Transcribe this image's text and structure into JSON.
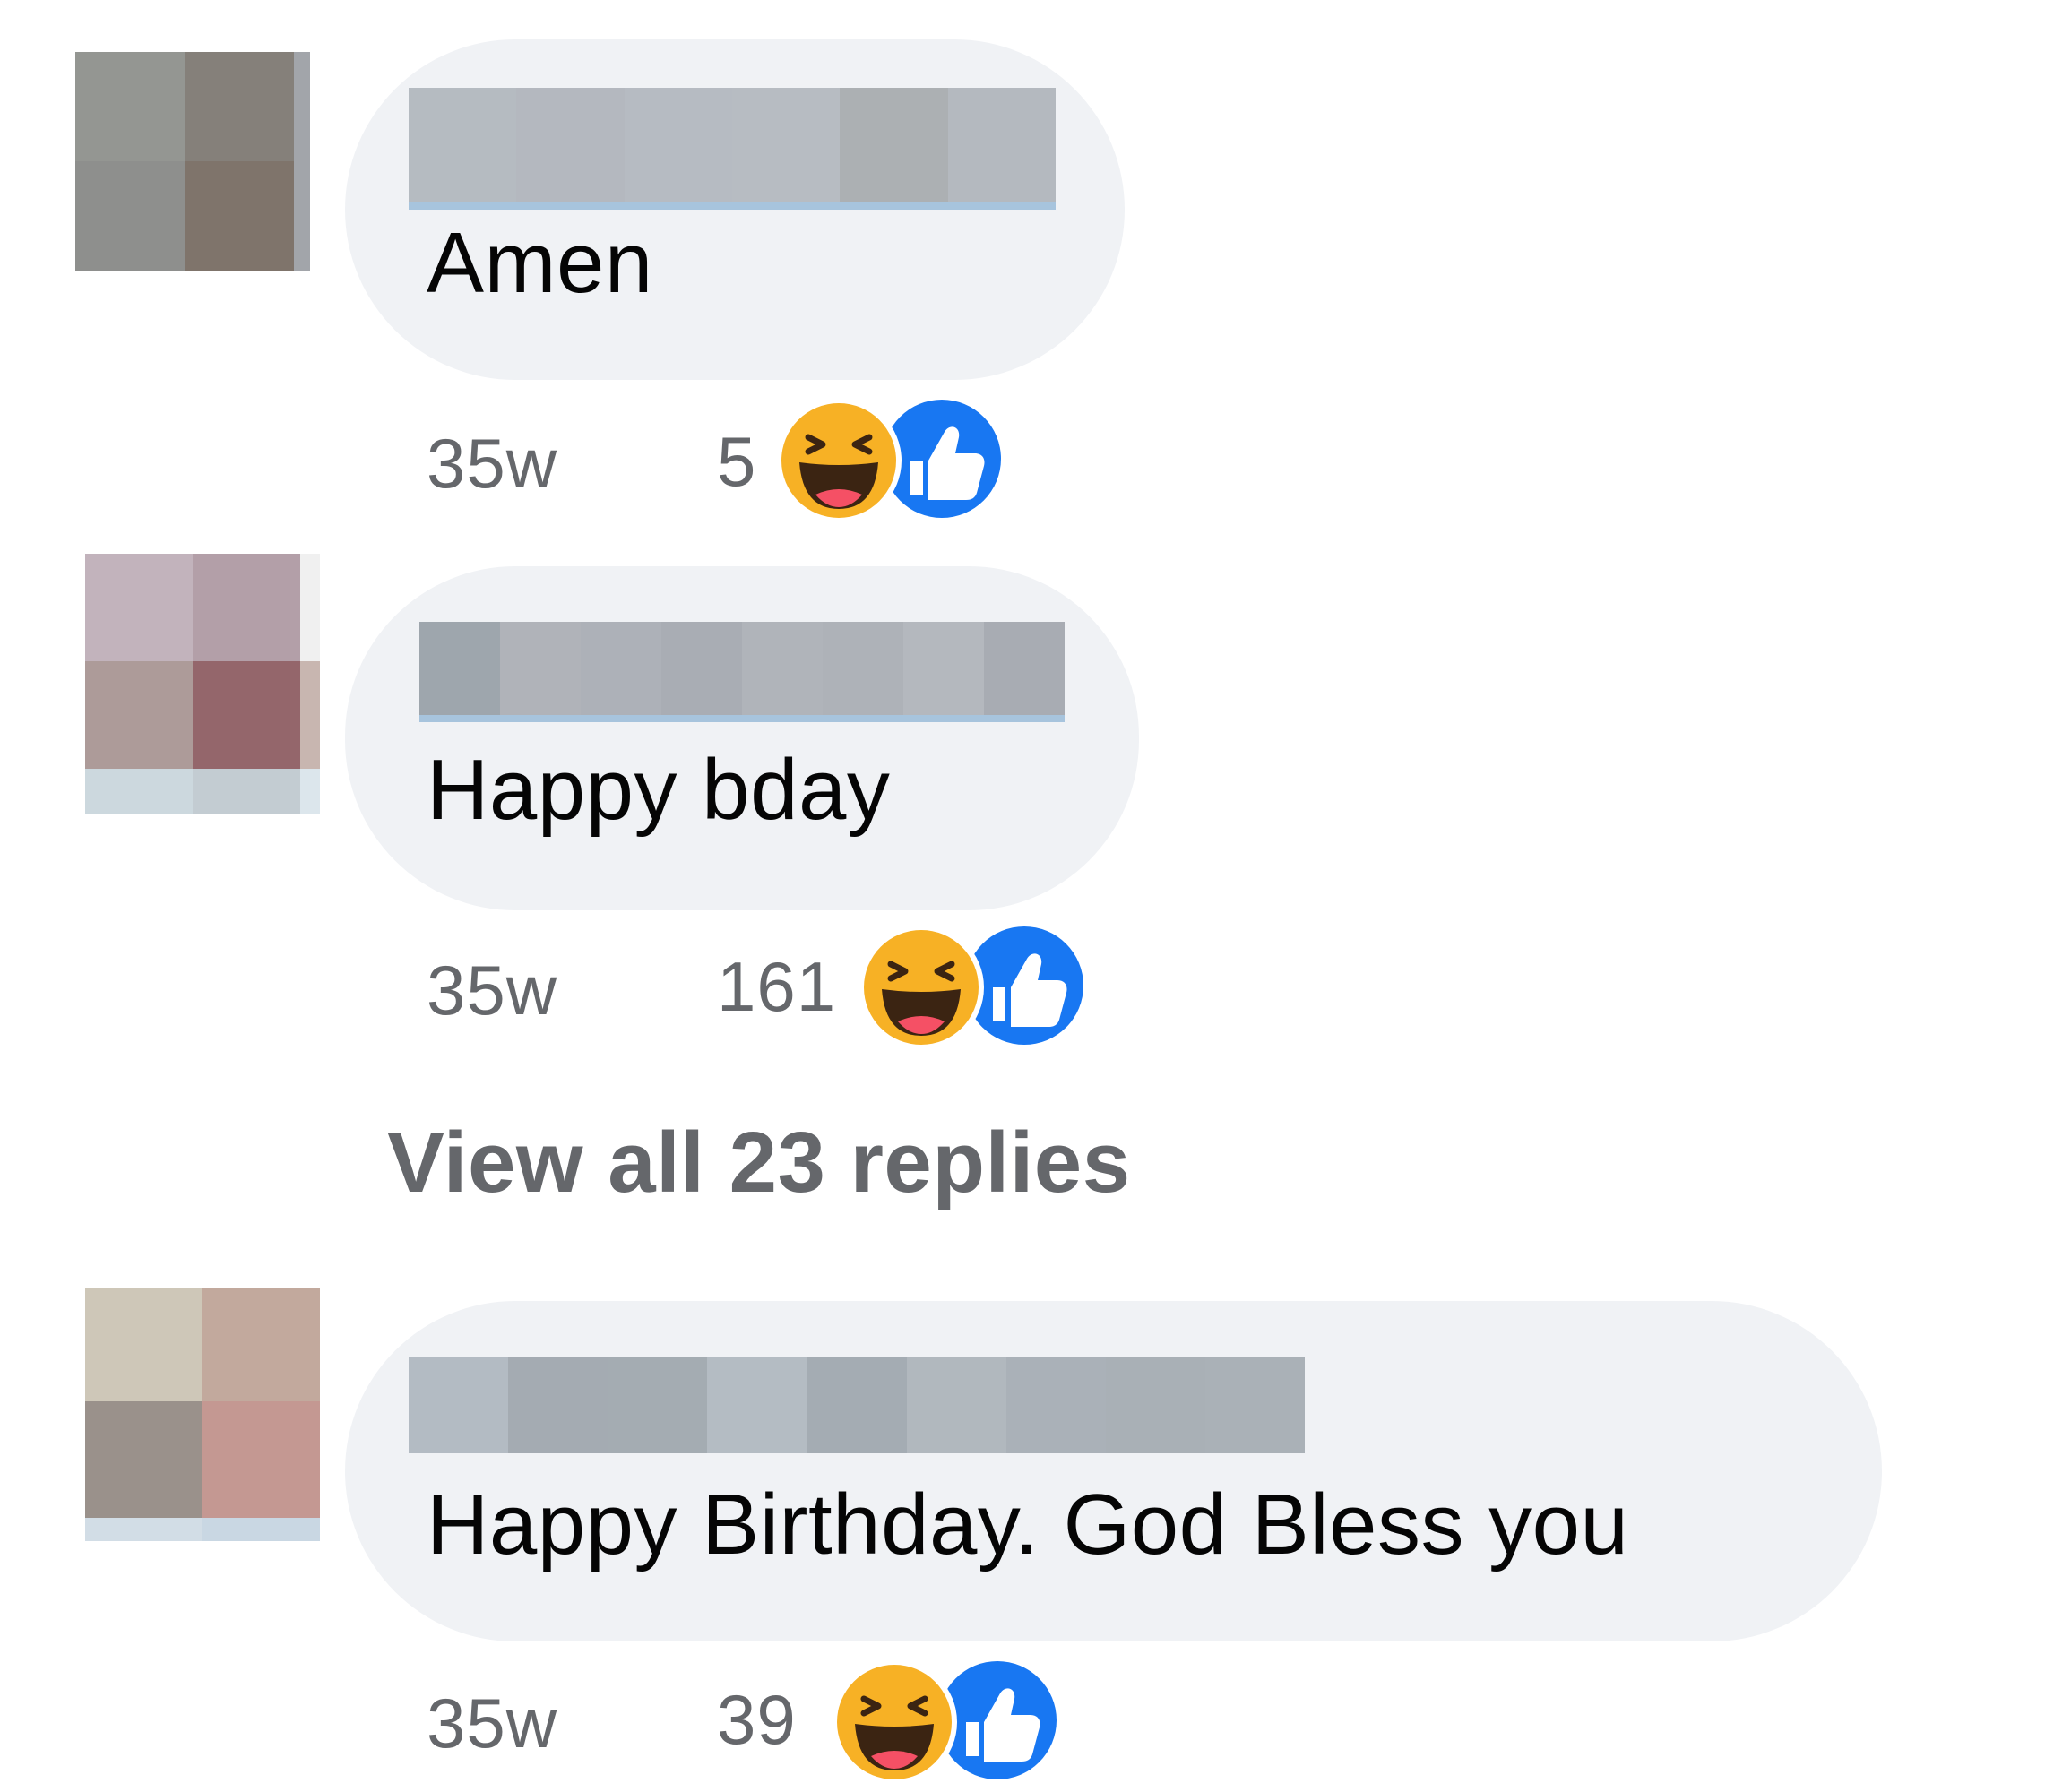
{
  "comments": [
    {
      "text": "Amen",
      "time": "35w",
      "reaction_count": "5",
      "reactions": [
        "haha-icon",
        "like-icon"
      ]
    },
    {
      "text": "Happy bday",
      "time": "35w",
      "reaction_count": "161",
      "reactions": [
        "haha-icon",
        "like-icon"
      ]
    },
    {
      "text": "Happy Birthday. God Bless you",
      "time": "35w",
      "reaction_count": "39",
      "reactions": [
        "haha-icon",
        "like-icon"
      ]
    }
  ],
  "view_replies": "View all 23 replies",
  "colors": {
    "bubble": "#f0f2f5",
    "meta_text": "#65676b",
    "comment_text": "#050505",
    "like_blue": "#1877f2",
    "haha_yellow": "#f7b125"
  }
}
